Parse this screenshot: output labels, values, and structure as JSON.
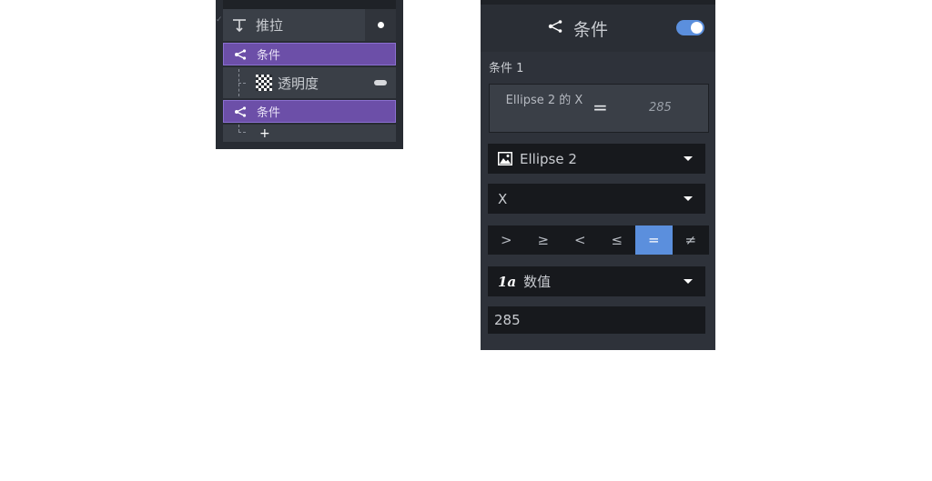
{
  "left_panel": {
    "action_row": {
      "label": "推拉"
    },
    "condition_row_1": {
      "label": "条件"
    },
    "opacity_row": {
      "label": "透明度"
    },
    "condition_row_2": {
      "label": "条件"
    },
    "add_row": {
      "label": "+"
    }
  },
  "right_panel": {
    "header": {
      "title": "条件",
      "toggle_on": true
    },
    "section_label": "条件 1",
    "summary": {
      "lhs": "Ellipse 2 的 X",
      "operator": "=",
      "rhs": "285"
    },
    "target_dropdown": {
      "value": "Ellipse 2",
      "icon": "image-icon"
    },
    "property_dropdown": {
      "value": "X"
    },
    "operators": [
      ">",
      "≥",
      "<",
      "≤",
      "=",
      "≠"
    ],
    "active_operator": "=",
    "type_dropdown": {
      "value": "数值",
      "icon_text": "1a"
    },
    "value_input": {
      "value": "285"
    }
  },
  "colors": {
    "accent": "#5b8fdd",
    "condition_purple": "#6c4fa8",
    "panel_bg": "#2e323a",
    "input_bg": "#17191d"
  }
}
